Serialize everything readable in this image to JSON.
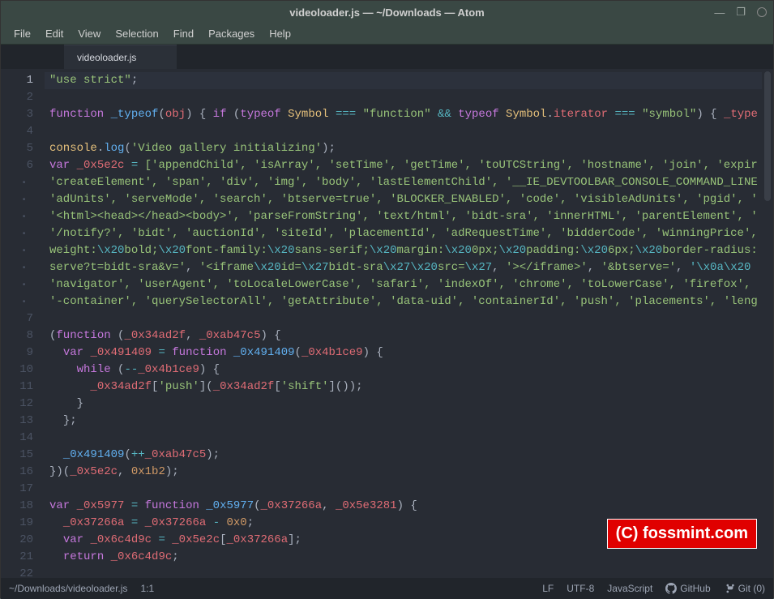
{
  "window": {
    "title": "videoloader.js — ~/Downloads — Atom"
  },
  "menu": {
    "file": "File",
    "edit": "Edit",
    "view": "View",
    "selection": "Selection",
    "find": "Find",
    "packages": "Packages",
    "help": "Help"
  },
  "tab": {
    "name": "videoloader.js"
  },
  "gutter": {
    "l1": "1",
    "l2": "2",
    "l3": "3",
    "l4": "4",
    "l5": "5",
    "l6": "6",
    "l7": "7",
    "l8": "8",
    "l9": "9",
    "l10": "10",
    "l11": "11",
    "l12": "12",
    "l13": "13",
    "l14": "14",
    "l15": "15",
    "l16": "16",
    "l17": "17",
    "l18": "18",
    "l19": "19",
    "l20": "20",
    "l21": "21",
    "l22": "22"
  },
  "code": {
    "l1_str": "\"use strict\"",
    "l3_kw_function": "function",
    "l3_fn_typeof": "_typeof",
    "l3_var_obj": "obj",
    "l3_kw_if": "if",
    "l3_kw_typeof1": "typeof",
    "l3_sym": "Symbol",
    "l3_op_eqeqeq": "===",
    "l3_str_function": "\"function\"",
    "l3_op_and": "&&",
    "l3_kw_typeof2": "typeof",
    "l3_sym2": "Symbol",
    "l3_prop_iterator": "iterator",
    "l3_str_symbol": "\"symbol\"",
    "l3_tail": "_type",
    "l5_console": "console",
    "l5_log": "log",
    "l5_str": "'Video gallery initializing'",
    "l6_kw_var": "var",
    "l6_name": "_0x5e2c",
    "l6_items": "['appendChild', 'isArray', 'setTime', 'getTime', 'toUTCString', 'hostname', 'join', 'expir",
    "l6a": "'createElement', 'span', 'div', 'img', 'body', 'lastElementChild', '__IE_DEVTOOLBAR_CONSOLE_COMMAND_LINE",
    "l6b": "'adUnits', 'serveMode', 'search', 'btserve=true', 'BLOCKER_ENABLED', 'code', 'visibleAdUnits', 'pgid', '",
    "l6c": "'<html><head></head><body>', 'parseFromString', 'text/html', 'bidt-sra', 'innerHTML', 'parentElement', '",
    "l6d": "'/notify?', 'bidt', 'auctionId', 'siteId', 'placementId', 'adRequestTime', 'bidderCode', 'winningPrice',",
    "l6e_pre": "weight:",
    "l6e_esc1": "\\x20",
    "l6e_bold": "bold;",
    "l6e_ff": "font-family:",
    "l6e_ss": "sans-serif;",
    "l6e_margin": "margin:",
    "l6e_0px": "0px;",
    "l6e_padding": "padding:",
    "l6e_6px": "6px;",
    "l6e_br": "border-radius:",
    "l6f_pre": "serve?t=bidt-sra&v='",
    "l6f_iframe": "'<iframe",
    "l6f_esc": "\\x20",
    "l6f_id": "id=",
    "l6f_x27": "\\x27",
    "l6f_bidtsra": "bidt-sra",
    "l6f_src": "src=",
    "l6f_close": "'></iframe>'",
    "l6f_btserve": "'&btserve='",
    "l6f_x0a": "'\\x0a\\x20",
    "l6g": "'navigator', 'userAgent', 'toLocaleLowerCase', 'safari', 'indexOf', 'chrome', 'toLowerCase', 'firefox',",
    "l6h": "'-container', 'querySelectorAll', 'getAttribute', 'data-uid', 'containerId', 'push', 'placements', 'leng",
    "l8_kw_function": "function",
    "l8_a": "_0x34ad2f",
    "l8_b": "_0xab47c5",
    "l9_kw_var": "var",
    "l9_name": "_0x491409",
    "l9_kw_function": "function",
    "l9_fn": "_0x491409",
    "l9_arg": "_0x4b1ce9",
    "l10_kw_while": "while",
    "l10_arg": "_0x4b1ce9",
    "l11_a": "_0x34ad2f",
    "l11_push": "'push'",
    "l11_shift": "'shift'",
    "l15_fn": "_0x491409",
    "l15_arg": "_0xab47c5",
    "l16_a": "_0x5e2c",
    "l16_b": "0x1b2",
    "l18_kw_var": "var",
    "l18_name": "_0x5977",
    "l18_kw_function": "function",
    "l18_fn": "_0x5977",
    "l18_arg1": "_0x37266a",
    "l18_arg2": "_0x5e3281",
    "l19_a": "_0x37266a",
    "l19_zero": "0x0",
    "l20_kw_var": "var",
    "l20_name": "_0x6c4d9c",
    "l20_arr": "_0x5e2c",
    "l20_idx": "_0x37266a",
    "l21_kw_return": "return",
    "l21_name": "_0x6c4d9c"
  },
  "statusbar": {
    "path": "~/Downloads/videoloader.js",
    "cursor": "1:1",
    "lineending": "LF",
    "encoding": "UTF-8",
    "language": "JavaScript",
    "github": "GitHub",
    "git": "Git (0)"
  },
  "watermark": {
    "text": "(C) fossmint.com"
  }
}
